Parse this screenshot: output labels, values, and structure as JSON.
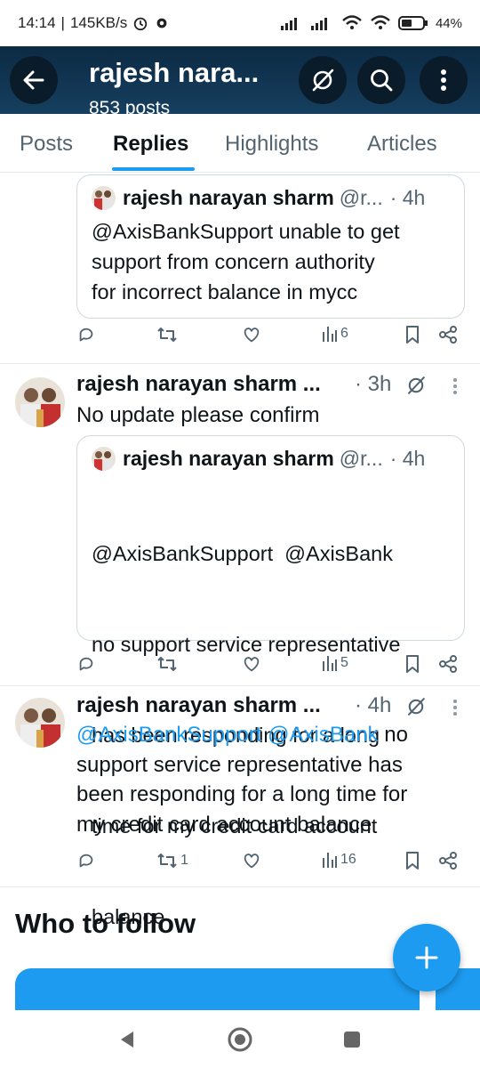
{
  "status_bar": {
    "time": "14:14",
    "speed": "145KB/s",
    "battery": "44"
  },
  "header": {
    "title": "rajesh nara...",
    "subtitle": "853 posts"
  },
  "tabs": [
    {
      "label": "Posts",
      "active": false
    },
    {
      "label": "Replies",
      "active": true
    },
    {
      "label": "Highlights",
      "active": false
    },
    {
      "label": "Articles",
      "active": false
    }
  ],
  "quote1": {
    "name": "rajesh narayan sharm",
    "handle": "@r...",
    "time": "· 4h",
    "lines": [
      "@AxisBankSupport unable to get",
      "support from concern authority",
      "for incorrect balance in mycc"
    ]
  },
  "actions1": {
    "views": "6"
  },
  "tweet2": {
    "name": "rajesh narayan sharm ...",
    "time": "· 3h",
    "text": "No update please confirm"
  },
  "quote2": {
    "name": "rajesh narayan sharm",
    "handle": "@r...",
    "time": "· 4h",
    "lines": [
      "@AxisBankSupport  @AxisBank",
      "no support service representative",
      "has been responding for a long",
      "time for my credit card account",
      "balance"
    ]
  },
  "actions2": {
    "views": "5"
  },
  "tweet3": {
    "name": "rajesh narayan sharm ...",
    "time": "· 4h",
    "mention1": "@AxisBankSupport",
    "mention2": "@AxisBank",
    "line1_rest": "no",
    "lines": [
      "support service representative has",
      "been responding for a long time for",
      "my credit card account balance"
    ]
  },
  "actions3": {
    "retweets": "1",
    "views": "16"
  },
  "who_to_follow": "Who to follow",
  "colors": {
    "accent": "#1d9bf0",
    "header_bg": "#0c2a44",
    "muted": "#536471"
  }
}
